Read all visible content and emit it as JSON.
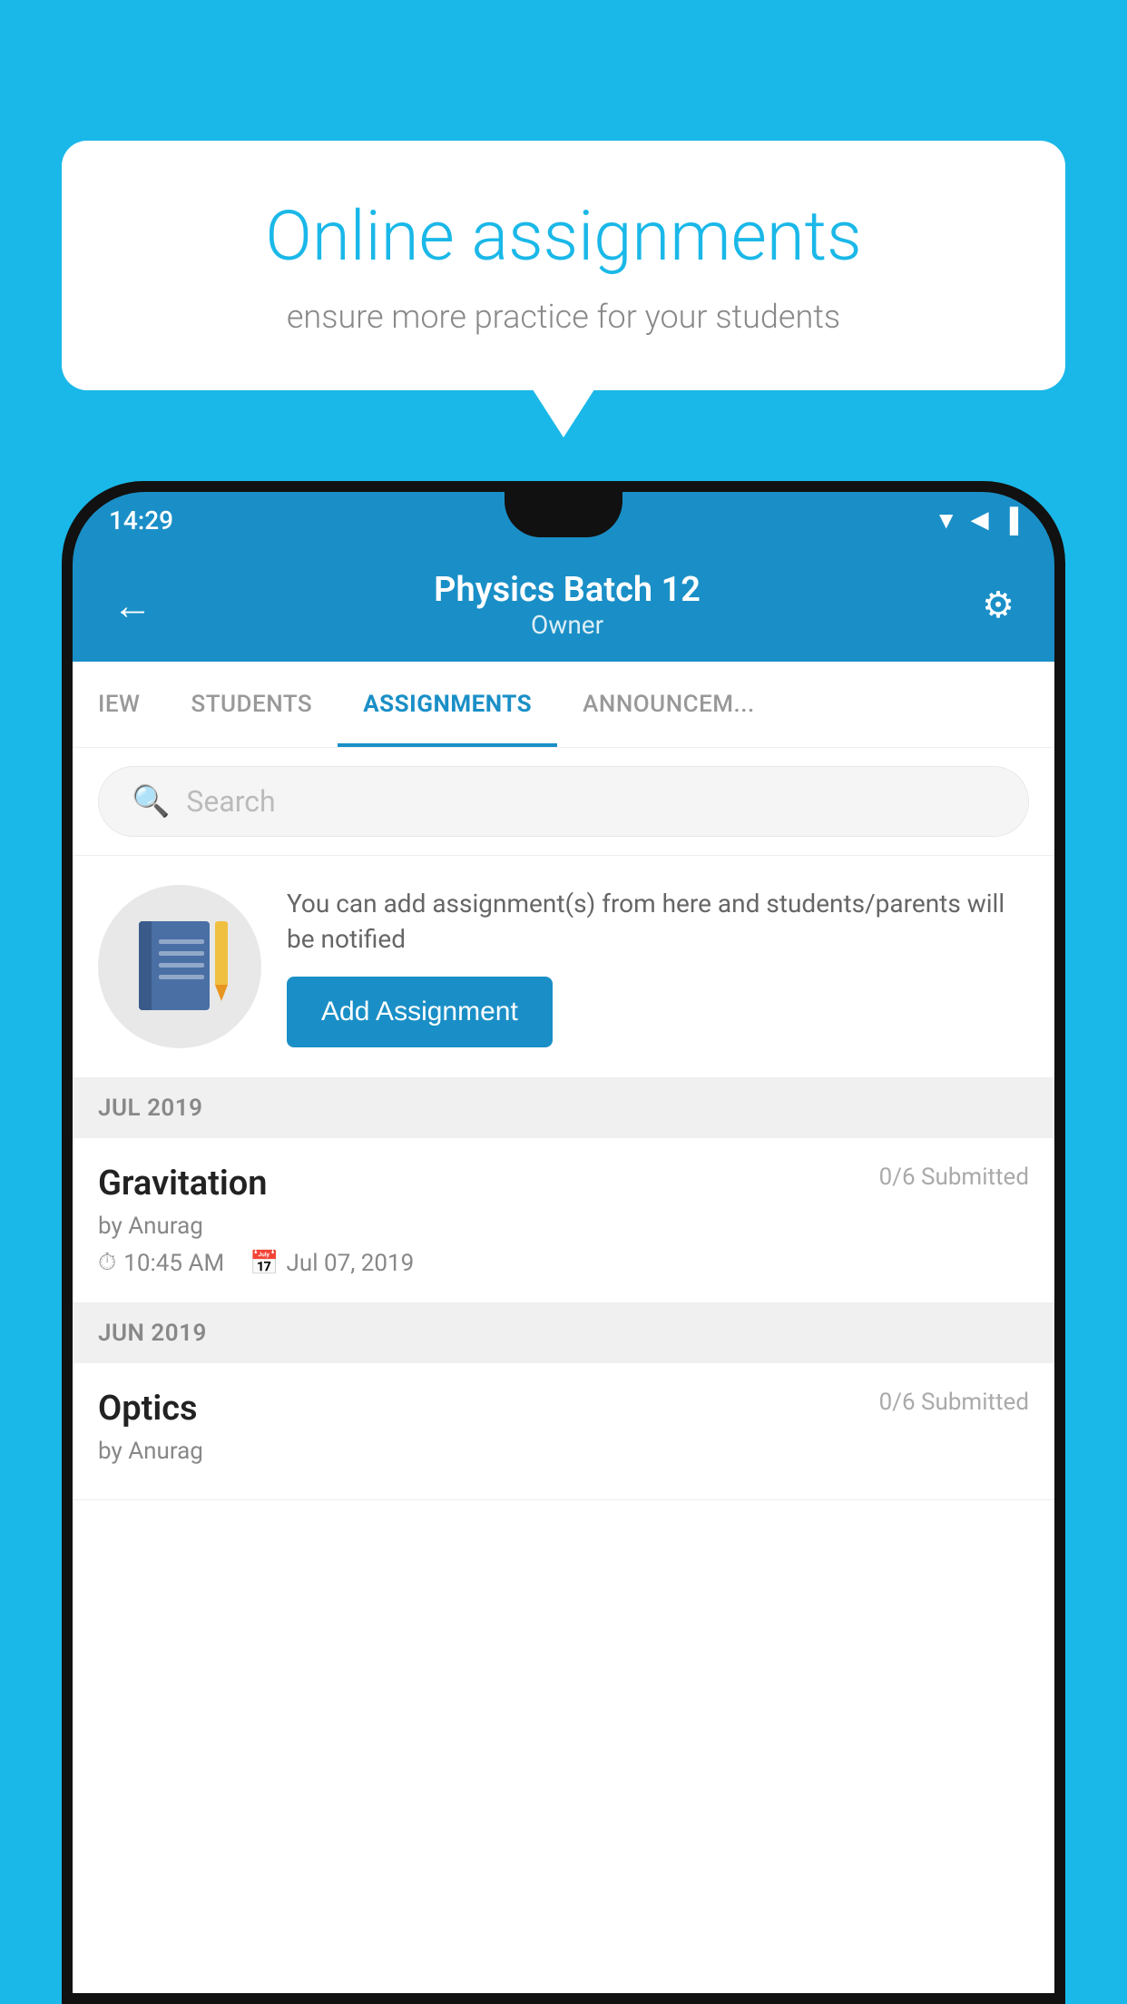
{
  "background_color": "#1ab8e8",
  "speech_bubble": {
    "title": "Online assignments",
    "subtitle": "ensure more practice for your students"
  },
  "phone": {
    "status_bar": {
      "time": "14:29"
    },
    "header": {
      "back_label": "←",
      "batch_title": "Physics Batch 12",
      "batch_subtitle": "Owner",
      "gear_label": "⚙"
    },
    "tabs": [
      {
        "label": "IEW",
        "active": false
      },
      {
        "label": "STUDENTS",
        "active": false
      },
      {
        "label": "ASSIGNMENTS",
        "active": true
      },
      {
        "label": "ANNOUNCEM...",
        "active": false
      }
    ],
    "search": {
      "placeholder": "Search"
    },
    "promo": {
      "description": "You can add assignment(s) from here and students/parents will be notified",
      "button_label": "Add Assignment"
    },
    "sections": [
      {
        "month": "JUL 2019",
        "assignments": [
          {
            "name": "Gravitation",
            "submitted": "0/6 Submitted",
            "by": "by Anurag",
            "time": "10:45 AM",
            "date": "Jul 07, 2019"
          }
        ]
      },
      {
        "month": "JUN 2019",
        "assignments": [
          {
            "name": "Optics",
            "submitted": "0/6 Submitted",
            "by": "by Anurag",
            "time": "",
            "date": ""
          }
        ]
      }
    ]
  }
}
